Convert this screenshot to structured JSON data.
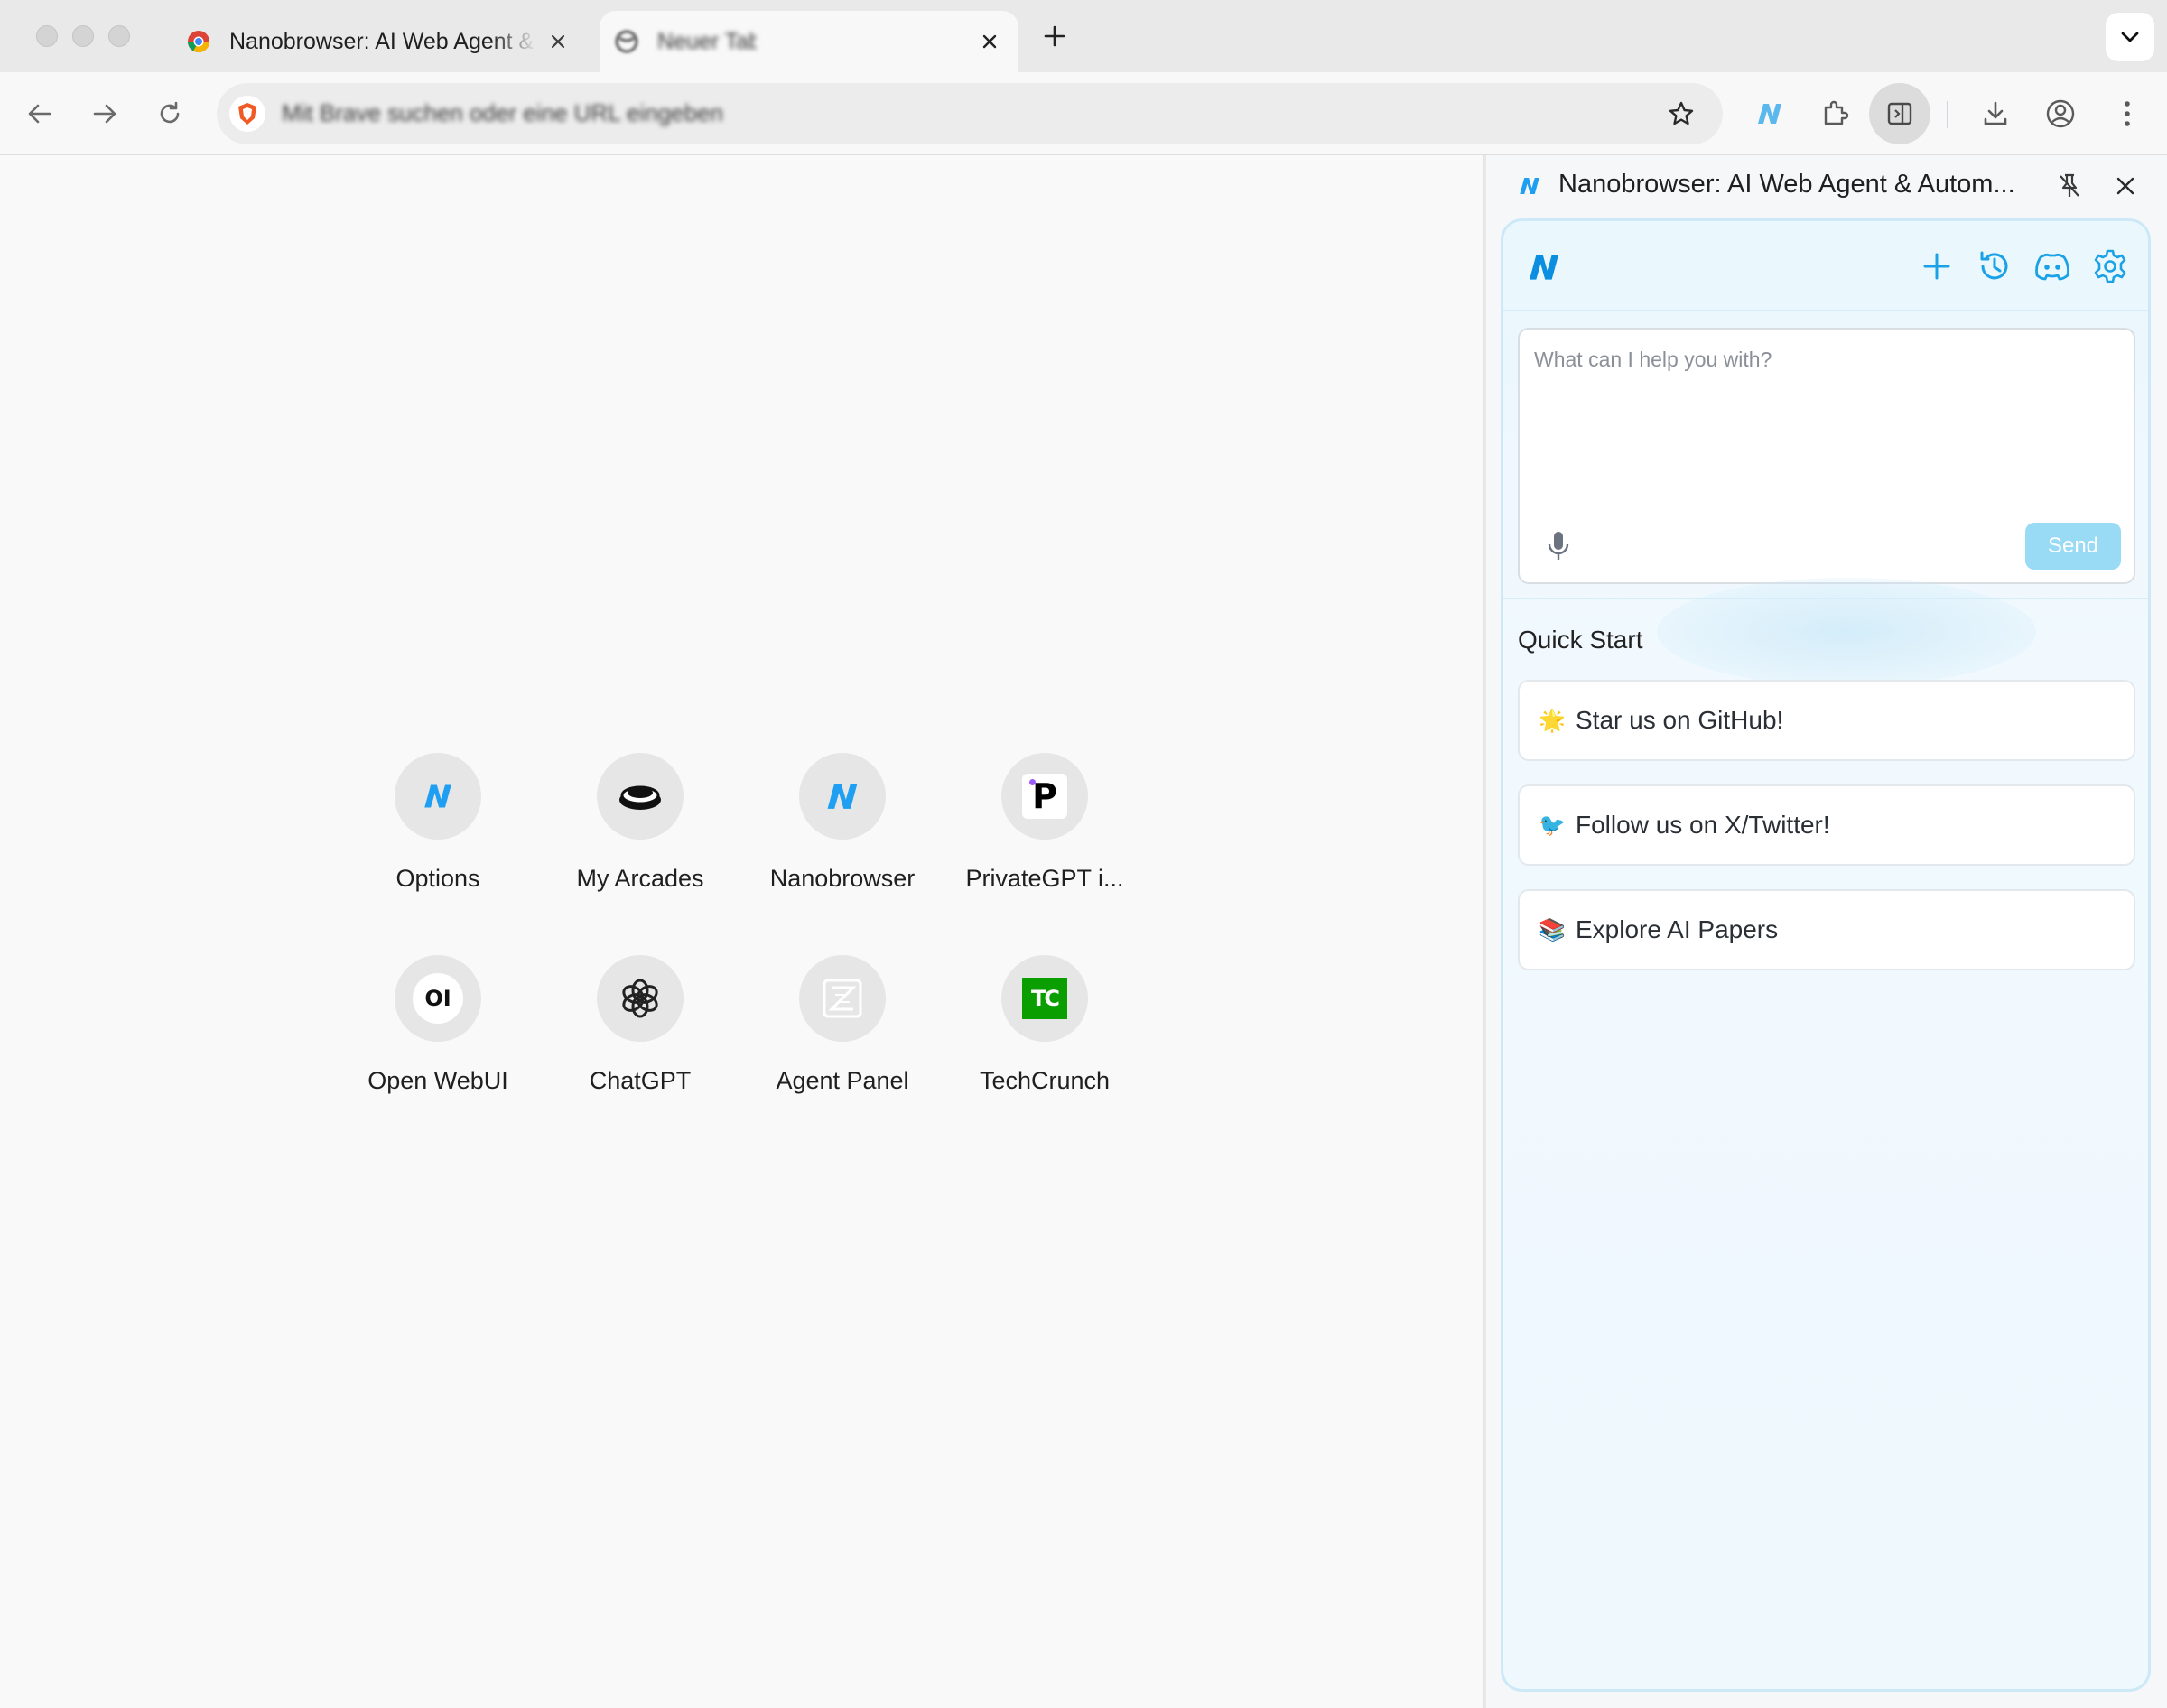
{
  "browser": {
    "tabs": [
      {
        "title": "Nanobrowser: AI Web Agent & Automation",
        "active": false
      },
      {
        "title": "Neuer Tab",
        "active": true
      }
    ],
    "omnibox": {
      "placeholder": "Mit Brave suchen oder eine URL eingeben"
    }
  },
  "shortcuts": [
    {
      "label": "Options",
      "icon": "nanobrowser-logo-icon"
    },
    {
      "label": "My Arcades",
      "icon": "arcade-button-icon"
    },
    {
      "label": "Nanobrowser",
      "icon": "nanobrowser-logo-icon"
    },
    {
      "label": "PrivateGPT i...",
      "icon": "privategpt-logo-icon"
    },
    {
      "label": "Open WebUI",
      "icon": "openwebui-logo-icon"
    },
    {
      "label": "ChatGPT",
      "icon": "chatgpt-logo-icon"
    },
    {
      "label": "Agent Panel",
      "icon": "agent-panel-logo-icon"
    },
    {
      "label": "TechCrunch",
      "icon": "techcrunch-logo-icon"
    }
  ],
  "sidepanel": {
    "title": "Nanobrowser: AI Web Agent & Autom...",
    "chat": {
      "placeholder": "What can I help you with?",
      "send_label": "Send"
    },
    "quick_start": {
      "title": "Quick Start",
      "items": [
        {
          "emoji": "🌟",
          "label": "Star us on GitHub!"
        },
        {
          "emoji": "🐦",
          "label": "Follow us on X/Twitter!"
        },
        {
          "emoji": "📚",
          "label": "Explore AI Papers"
        }
      ]
    }
  },
  "colors": {
    "accent": "#0ea5e9",
    "send_disabled": "#99daf5",
    "panel_border": "#cde9f7"
  }
}
